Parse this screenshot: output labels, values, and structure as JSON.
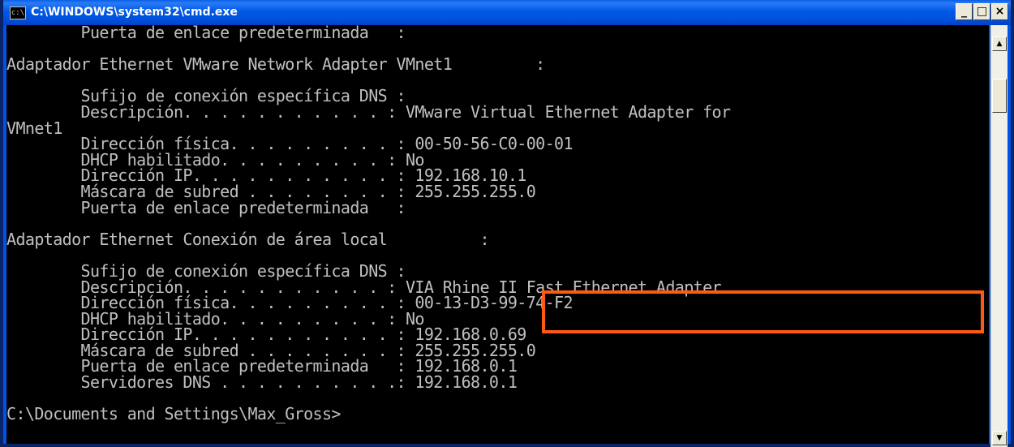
{
  "window": {
    "title": "C:\\WINDOWS\\system32\\cmd.exe",
    "icon_text": "c:\\",
    "buttons": {
      "minimize": "_",
      "maximize": "□",
      "close": "×"
    }
  },
  "console": {
    "lines": [
      "        Puerta de enlace predeterminada   :",
      "",
      "Adaptador Ethernet VMware Network Adapter VMnet1         :",
      "",
      "        Sufijo de conexión específica DNS :",
      "        Descripción. . . . . . . . . . . : VMware Virtual Ethernet Adapter for",
      "VMnet1",
      "        Dirección física. . . . . . . . . : 00-50-56-C0-00-01",
      "        DHCP habilitado. . . . . . . . . : No",
      "        Dirección IP. . . . . . . . . . . : 192.168.10.1",
      "        Máscara de subred . . . . . . . . : 255.255.255.0",
      "        Puerta de enlace predeterminada   :",
      "",
      "Adaptador Ethernet Conexión de área local          :",
      "",
      "        Sufijo de conexión específica DNS :",
      "        Descripción. . . . . . . . . . . : VIA Rhine II Fast Ethernet Adapter",
      "        Dirección física. . . . . . . . . : 00-13-D3-99-74-F2",
      "        DHCP habilitado. . . . . . . . . : No",
      "        Dirección IP. . . . . . . . . . . : 192.168.0.69",
      "        Máscara de subred . . . . . . . . : 255.255.255.0",
      "        Puerta de enlace predeterminada   : 192.168.0.1",
      "        Servidores DNS . . . . . . . . . .: 192.168.0.1",
      "",
      "C:\\Documents and Settings\\Max_Gross>"
    ],
    "text_color": "#c0c0c0",
    "background": "#000000",
    "highlight_color": "#ff5a14"
  },
  "scrollbar": {
    "up": "▲",
    "down": "▼"
  }
}
